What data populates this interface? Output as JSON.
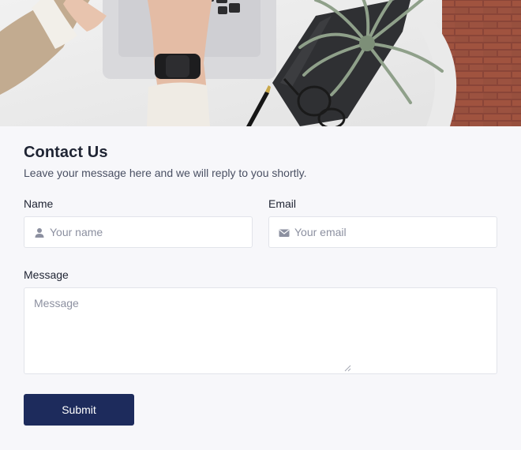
{
  "header_image": {
    "icon": "desk-workspace-photo"
  },
  "form": {
    "title": "Contact Us",
    "subtitle": "Leave your message here and we will reply to you shortly.",
    "name": {
      "label": "Name",
      "placeholder": "Your name",
      "value": "",
      "icon": "user-icon"
    },
    "email": {
      "label": "Email",
      "placeholder": "Your email",
      "value": "",
      "icon": "envelope-icon"
    },
    "message": {
      "label": "Message",
      "placeholder": "Message",
      "value": ""
    },
    "submit_label": "Submit"
  },
  "colors": {
    "background": "#f7f7fa",
    "accent": "#1d2b5c",
    "border": "#e2e4ea",
    "placeholder": "#8c90a0"
  }
}
